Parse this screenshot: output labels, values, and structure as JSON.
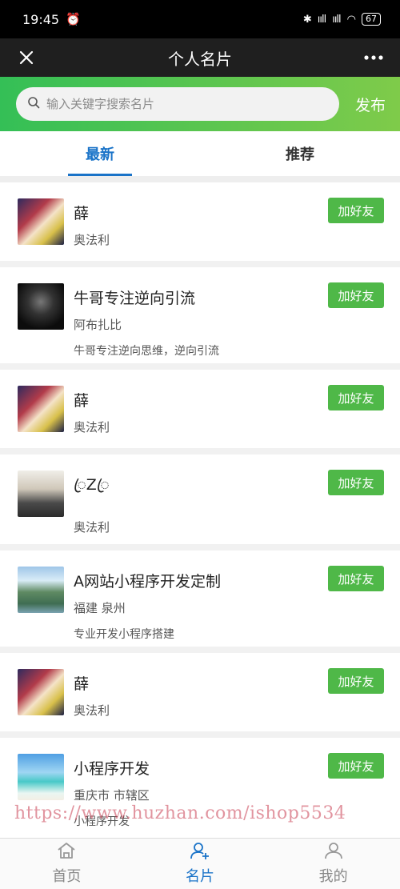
{
  "status": {
    "time": "19:45",
    "battery": "67",
    "signal": "ııll",
    "signal2": "ııll"
  },
  "nav": {
    "title": "个人名片"
  },
  "search": {
    "placeholder": "输入关键字搜索名片",
    "publish": "发布"
  },
  "tabs": [
    {
      "label": "最新",
      "active": true
    },
    {
      "label": "推荐",
      "active": false
    }
  ],
  "cards": [
    {
      "name": "薛",
      "location": "奥法利",
      "desc": "",
      "button": "加好友",
      "avatar": "avatar-a"
    },
    {
      "name": "牛哥专注逆向引流",
      "location": "阿布扎比",
      "desc": "牛哥专注逆向思维，逆向引流",
      "button": "加好友",
      "avatar": "avatar-b"
    },
    {
      "name": "薛",
      "location": "奥法利",
      "desc": "",
      "button": "加好友",
      "avatar": "avatar-a"
    },
    {
      "name": "ꦿZꦿ",
      "location": "奥法利",
      "desc": "",
      "button": "加好友",
      "avatar": "avatar-c"
    },
    {
      "name": "A网站小程序开发定制",
      "location": "福建 泉州",
      "desc": "专业开发小程序搭建",
      "button": "加好友",
      "avatar": "avatar-d"
    },
    {
      "name": "薛",
      "location": "奥法利",
      "desc": "",
      "button": "加好友",
      "avatar": "avatar-a"
    },
    {
      "name": "小程序开发",
      "location": "重庆市 市辖区",
      "desc": "小程序开发",
      "button": "加好友",
      "avatar": "avatar-e"
    }
  ],
  "watermark": "https://www.huzhan.com/ishop5534",
  "tabbar": [
    {
      "label": "首页",
      "icon": "home-icon"
    },
    {
      "label": "名片",
      "icon": "person-add-icon"
    },
    {
      "label": "我的",
      "icon": "person-icon"
    }
  ],
  "colors": {
    "accent": "#1a73c8",
    "button": "#4fb848",
    "header_green_start": "#34bf56",
    "header_green_end": "#7fcb4a"
  }
}
